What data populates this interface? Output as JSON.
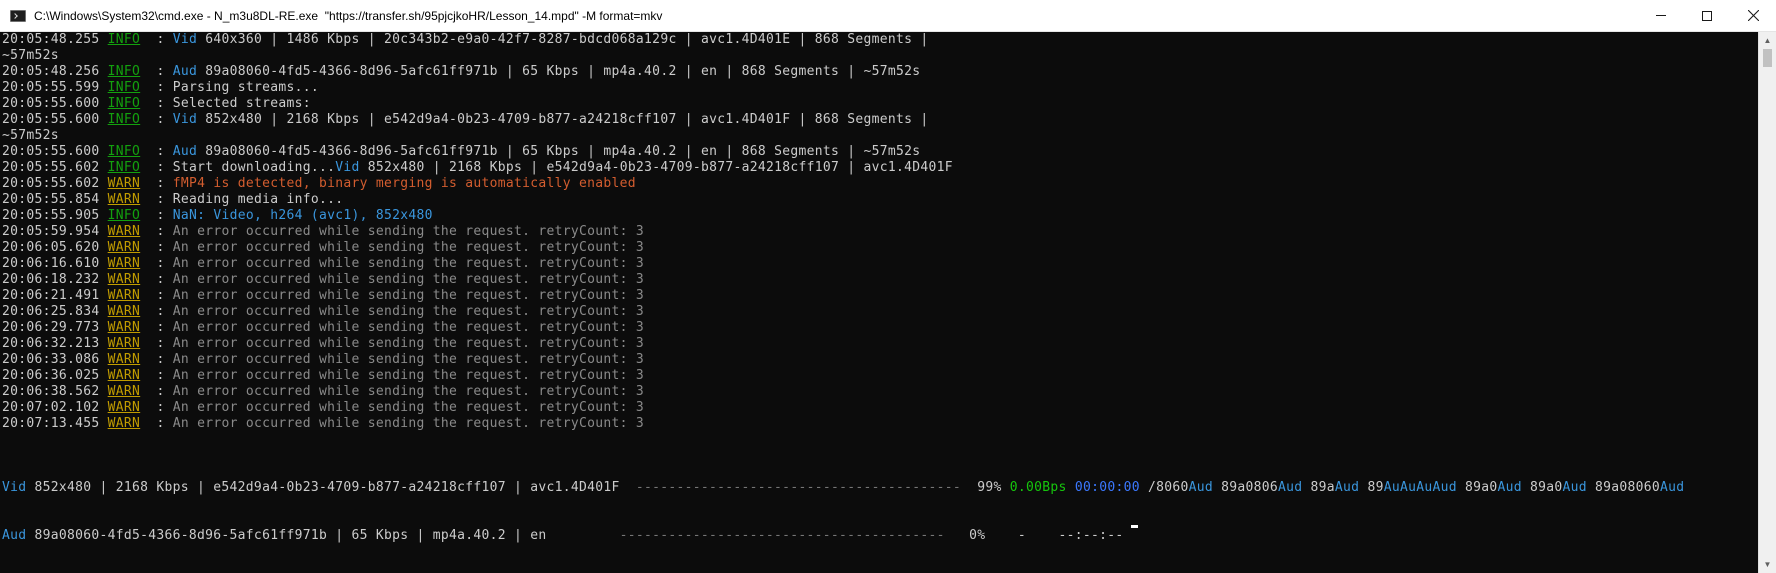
{
  "window": {
    "title": "C:\\Windows\\System32\\cmd.exe - N_m3u8DL-RE.exe  \"https://transfer.sh/95pjcjkoHR/Lesson_14.mpd\" -M format=mkv"
  },
  "log": [
    {
      "ts": "20:05:48.255",
      "lvl": "INFO",
      "type": "vid",
      "tag": "Vid",
      "msg": " 640x360 | 1486 Kbps | 20c343b2-e9a0-42f7-8287-bdcd068a129c | avc1.4D401E | 868 Segments |"
    },
    {
      "wrap": "~57m52s"
    },
    {
      "ts": "20:05:48.256",
      "lvl": "INFO",
      "type": "aud",
      "tag": "Aud",
      "msg": " 89a08060-4fd5-4366-8d96-5afc61ff971b | 65 Kbps | mp4a.40.2 | en | 868 Segments | ~57m52s"
    },
    {
      "ts": "20:05:55.599",
      "lvl": "INFO",
      "type": "plain",
      "msg": "Parsing streams..."
    },
    {
      "ts": "20:05:55.600",
      "lvl": "INFO",
      "type": "plain",
      "msg": "Selected streams:"
    },
    {
      "ts": "20:05:55.600",
      "lvl": "INFO",
      "type": "vid",
      "tag": "Vid",
      "msg": " 852x480 | 2168 Kbps | e542d9a4-0b23-4709-b877-a24218cff107 | avc1.4D401F | 868 Segments |"
    },
    {
      "wrap": "~57m52s"
    },
    {
      "ts": "20:05:55.600",
      "lvl": "INFO",
      "type": "aud",
      "tag": "Aud",
      "msg": " 89a08060-4fd5-4366-8d96-5afc61ff971b | 65 Kbps | mp4a.40.2 | en | 868 Segments | ~57m52s"
    },
    {
      "ts": "20:05:55.602",
      "lvl": "INFO",
      "type": "startdl",
      "pre": "Start downloading...",
      "tag": "Vid",
      "msg": " 852x480 | 2168 Kbps | e542d9a4-0b23-4709-b877-a24218cff107 | avc1.4D401F"
    },
    {
      "ts": "20:05:55.602",
      "lvl": "WARN",
      "type": "orange",
      "msg": "fMP4 is detected, binary merging is automatically enabled"
    },
    {
      "ts": "20:05:55.854",
      "lvl": "WARN",
      "type": "plain",
      "msg": "Reading media info..."
    },
    {
      "ts": "20:05:55.905",
      "lvl": "INFO",
      "type": "blue",
      "msg": "NaN: Video, h264 (avc1), 852x480"
    },
    {
      "ts": "20:05:59.954",
      "lvl": "WARN",
      "type": "dim",
      "msg": "An error occurred while sending the request. retryCount: 3"
    },
    {
      "ts": "20:06:05.620",
      "lvl": "WARN",
      "type": "dim",
      "msg": "An error occurred while sending the request. retryCount: 3"
    },
    {
      "ts": "20:06:16.610",
      "lvl": "WARN",
      "type": "dim",
      "msg": "An error occurred while sending the request. retryCount: 3"
    },
    {
      "ts": "20:06:18.232",
      "lvl": "WARN",
      "type": "dim",
      "msg": "An error occurred while sending the request. retryCount: 3"
    },
    {
      "ts": "20:06:21.491",
      "lvl": "WARN",
      "type": "dim",
      "msg": "An error occurred while sending the request. retryCount: 3"
    },
    {
      "ts": "20:06:25.834",
      "lvl": "WARN",
      "type": "dim",
      "msg": "An error occurred while sending the request. retryCount: 3"
    },
    {
      "ts": "20:06:29.773",
      "lvl": "WARN",
      "type": "dim",
      "msg": "An error occurred while sending the request. retryCount: 3"
    },
    {
      "ts": "20:06:32.213",
      "lvl": "WARN",
      "type": "dim",
      "msg": "An error occurred while sending the request. retryCount: 3"
    },
    {
      "ts": "20:06:33.086",
      "lvl": "WARN",
      "type": "dim",
      "msg": "An error occurred while sending the request. retryCount: 3"
    },
    {
      "ts": "20:06:36.025",
      "lvl": "WARN",
      "type": "dim",
      "msg": "An error occurred while sending the request. retryCount: 3"
    },
    {
      "ts": "20:06:38.562",
      "lvl": "WARN",
      "type": "dim",
      "msg": "An error occurred while sending the request. retryCount: 3"
    },
    {
      "ts": "20:07:02.102",
      "lvl": "WARN",
      "type": "dim",
      "msg": "An error occurred while sending the request. retryCount: 3"
    },
    {
      "ts": "20:07:13.455",
      "lvl": "WARN",
      "type": "dim",
      "msg": "An error occurred while sending the request. retryCount: 3"
    }
  ],
  "progress": {
    "video": {
      "tag": "Vid",
      "desc": " 852x480 | 2168 Kbps | e542d9a4-0b23-4709-b877-a24218cff107 | avc1.4D401F ",
      "bar": "----------------------------------------",
      "percent": "99%",
      "speed": "0.00Bps",
      "eta": "00:00:00",
      "tail": [
        {
          "t": "/8060",
          "c": "plain"
        },
        {
          "t": "Aud",
          "c": "aud"
        },
        {
          "t": " 89a0806",
          "c": "plain"
        },
        {
          "t": "Aud",
          "c": "aud"
        },
        {
          "t": " 89a",
          "c": "plain"
        },
        {
          "t": "Aud",
          "c": "aud"
        },
        {
          "t": " 89",
          "c": "plain"
        },
        {
          "t": "AuAuAuAud",
          "c": "aud"
        },
        {
          "t": " 89a0",
          "c": "plain"
        },
        {
          "t": "Aud",
          "c": "aud"
        },
        {
          "t": " 89a0",
          "c": "plain"
        },
        {
          "t": "Aud",
          "c": "aud"
        },
        {
          "t": " 89a08060",
          "c": "plain"
        },
        {
          "t": "Aud",
          "c": "aud"
        }
      ]
    },
    "audio": {
      "tag": "Aud",
      "desc": " 89a08060-4fd5-4366-8d96-5afc61ff971b | 65 Kbps | mp4a.40.2 | en",
      "pad": "         ",
      "bar": "----------------------------------------",
      "percent": "0%",
      "speed": "-",
      "eta": "--:--:--"
    }
  },
  "colors": {
    "background": "#0c0c0c",
    "text": "#cccccc",
    "info": "#13a10e",
    "warn": "#c19c00",
    "stream_tag": "#3a96dd",
    "orange_warning": "#d35d2f",
    "speed": "#16c60c",
    "eta": "#3b78ff"
  },
  "icons": {
    "title": "cmd-icon",
    "minimize": "minimize-icon",
    "maximize": "maximize-icon",
    "close": "close-icon"
  }
}
